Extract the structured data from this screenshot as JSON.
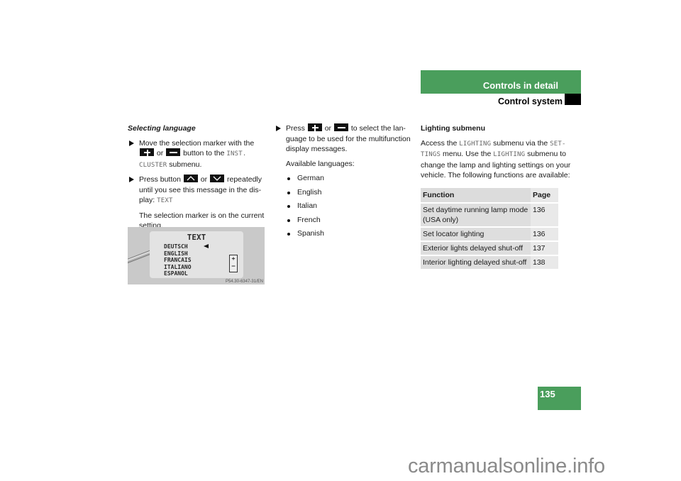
{
  "header": {
    "section": "Controls in detail",
    "subsection": "Control system",
    "accent_color": "#4a9e5c"
  },
  "page_number": "135",
  "column1": {
    "heading": "Selecting language",
    "step1": {
      "text_a": "Move the selection marker with the",
      "key1": "plus-button-icon",
      "text_or": "or",
      "key2": "minus-button-icon",
      "text_b": "button to the",
      "mono1": "INST.",
      "mono2": "CLUSTER",
      "text_c": "submenu."
    },
    "step2": {
      "text_a": "Press button",
      "key1": "up-button-icon",
      "text_or": "or",
      "key2": "down-button-icon",
      "text_b": "repeatedly until you see this message in the dis-play:",
      "mono": "TEXT"
    },
    "note": "The selection marker is on the current setting.",
    "display_image": {
      "title": "TEXT",
      "languages": [
        "DEUTSCH",
        "ENGLISH",
        "FRANCAIS",
        "ITALIANO",
        "ESPANOL"
      ],
      "plus": "+",
      "minus": "–",
      "code": "P54.30-6347-31/EN"
    }
  },
  "column2": {
    "step": {
      "text_a": "Press",
      "key1": "plus-button-icon",
      "text_or": "or",
      "key2": "minus-button-icon",
      "text_b": "to select the lan-guage to be used for the multifunction display messages."
    },
    "available_label": "Available languages:",
    "languages": [
      "German",
      "English",
      "Italian",
      "French",
      "Spanish"
    ]
  },
  "column3": {
    "heading": "Lighting submenu",
    "para": {
      "text_a": "Access the",
      "mono1": "LIGHTING",
      "text_b": "submenu via the",
      "mono2": "SET-TINGS",
      "text_c": "menu. Use the",
      "mono3": "LIGHTING",
      "text_d": "submenu to change the lamp and lighting settings on your vehicle. The following functions are available:"
    },
    "table": {
      "headers": [
        "Function",
        "Page"
      ],
      "rows": [
        [
          "Set daytime running lamp mode (USA only)",
          "136"
        ],
        [
          "Set locator lighting",
          "136"
        ],
        [
          "Exterior lights delayed shut-off",
          "137"
        ],
        [
          "Interior lighting delayed shut-off",
          "138"
        ]
      ]
    }
  },
  "watermark": "carmanualsonline.info"
}
